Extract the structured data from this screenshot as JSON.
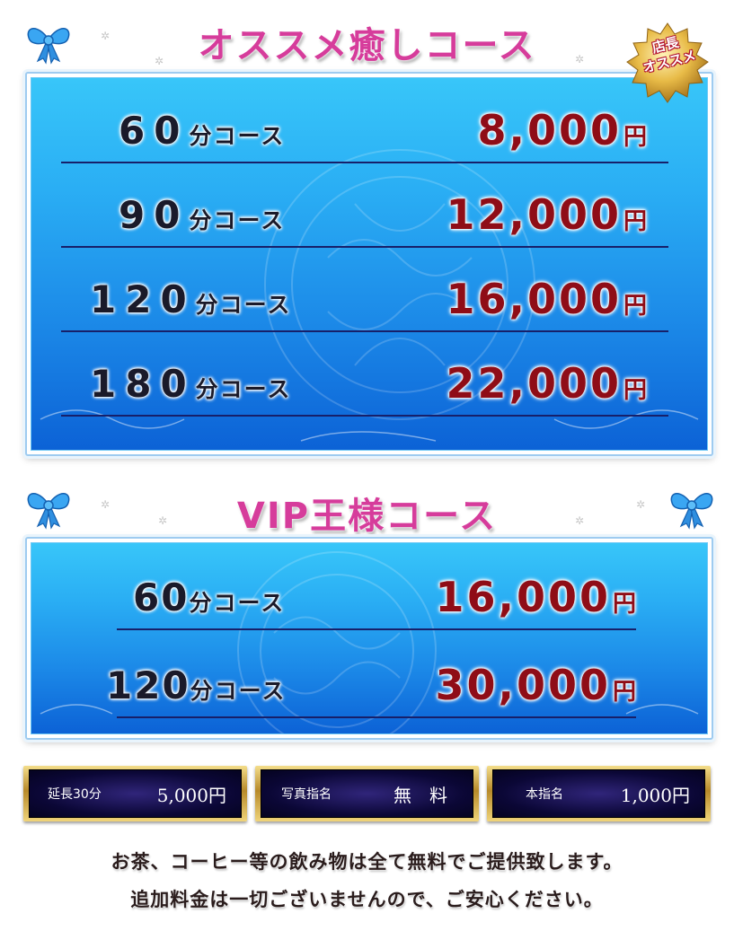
{
  "osusume": {
    "title": "オススメ癒しコース",
    "badge_line1": "店長",
    "badge_line2": "オススメ",
    "rows": [
      {
        "minutes": "60",
        "unit": "分コース",
        "price": "8,000",
        "yen": "円"
      },
      {
        "minutes": "90",
        "unit": "分コース",
        "price": "12,000",
        "yen": "円"
      },
      {
        "minutes": "120",
        "unit": "分コース",
        "price": "16,000",
        "yen": "円"
      },
      {
        "minutes": "180",
        "unit": "分コース",
        "price": "22,000",
        "yen": "円"
      }
    ]
  },
  "vip": {
    "title": "VIP王様コース",
    "rows": [
      {
        "minutes": "60",
        "unit": "分コース",
        "price": "16,000",
        "yen": "円"
      },
      {
        "minutes": "120",
        "unit": "分コース",
        "price": "30,000",
        "yen": "円"
      }
    ]
  },
  "extras": [
    {
      "label": "延長30分",
      "value": "5,000円"
    },
    {
      "label": "写真指名",
      "value": "無　料"
    },
    {
      "label": "本指名",
      "value": "1,000円"
    }
  ],
  "notes": {
    "line1": "お茶、コーヒー等の飲み物は全て無料でご提供致します。",
    "line2": "追加料金は一切ございませんので、ご安心ください。"
  },
  "colors": {
    "title": "#d63c9b",
    "price": "#8f0d17",
    "panel_top": "#38c6f9",
    "panel_bottom": "#0c62d6",
    "divider": "#17206a",
    "gold": "#d4a93e"
  },
  "icons": [
    "ribbon-bow-icon",
    "sparkle-icon",
    "star-badge-icon"
  ]
}
